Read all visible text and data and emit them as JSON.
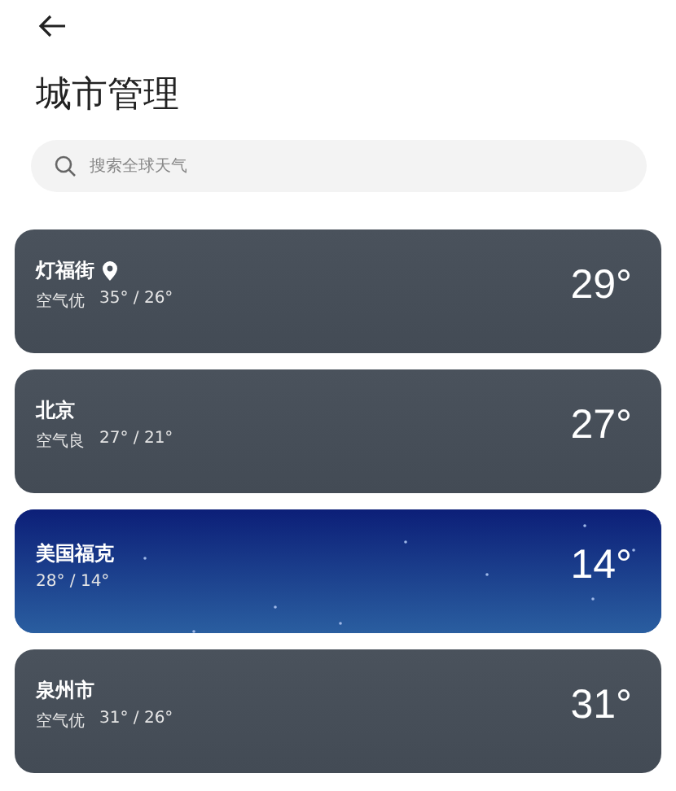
{
  "header": {
    "title": "城市管理"
  },
  "search": {
    "placeholder": "搜索全球天气"
  },
  "cities": [
    {
      "name": "灯福街",
      "current_location": true,
      "kind": "overcast",
      "air": "空气优",
      "range": "35° / 26°",
      "temp": "29°"
    },
    {
      "name": "北京",
      "current_location": false,
      "kind": "overcast",
      "air": "空气良",
      "range": "27° / 21°",
      "temp": "27°"
    },
    {
      "name": "美国福克",
      "current_location": false,
      "kind": "night",
      "range": "28° / 14°",
      "temp": "14°"
    },
    {
      "name": "泉州市",
      "current_location": false,
      "kind": "overcast",
      "air": "空气优",
      "range": "31° / 26°",
      "temp": "31°"
    }
  ]
}
